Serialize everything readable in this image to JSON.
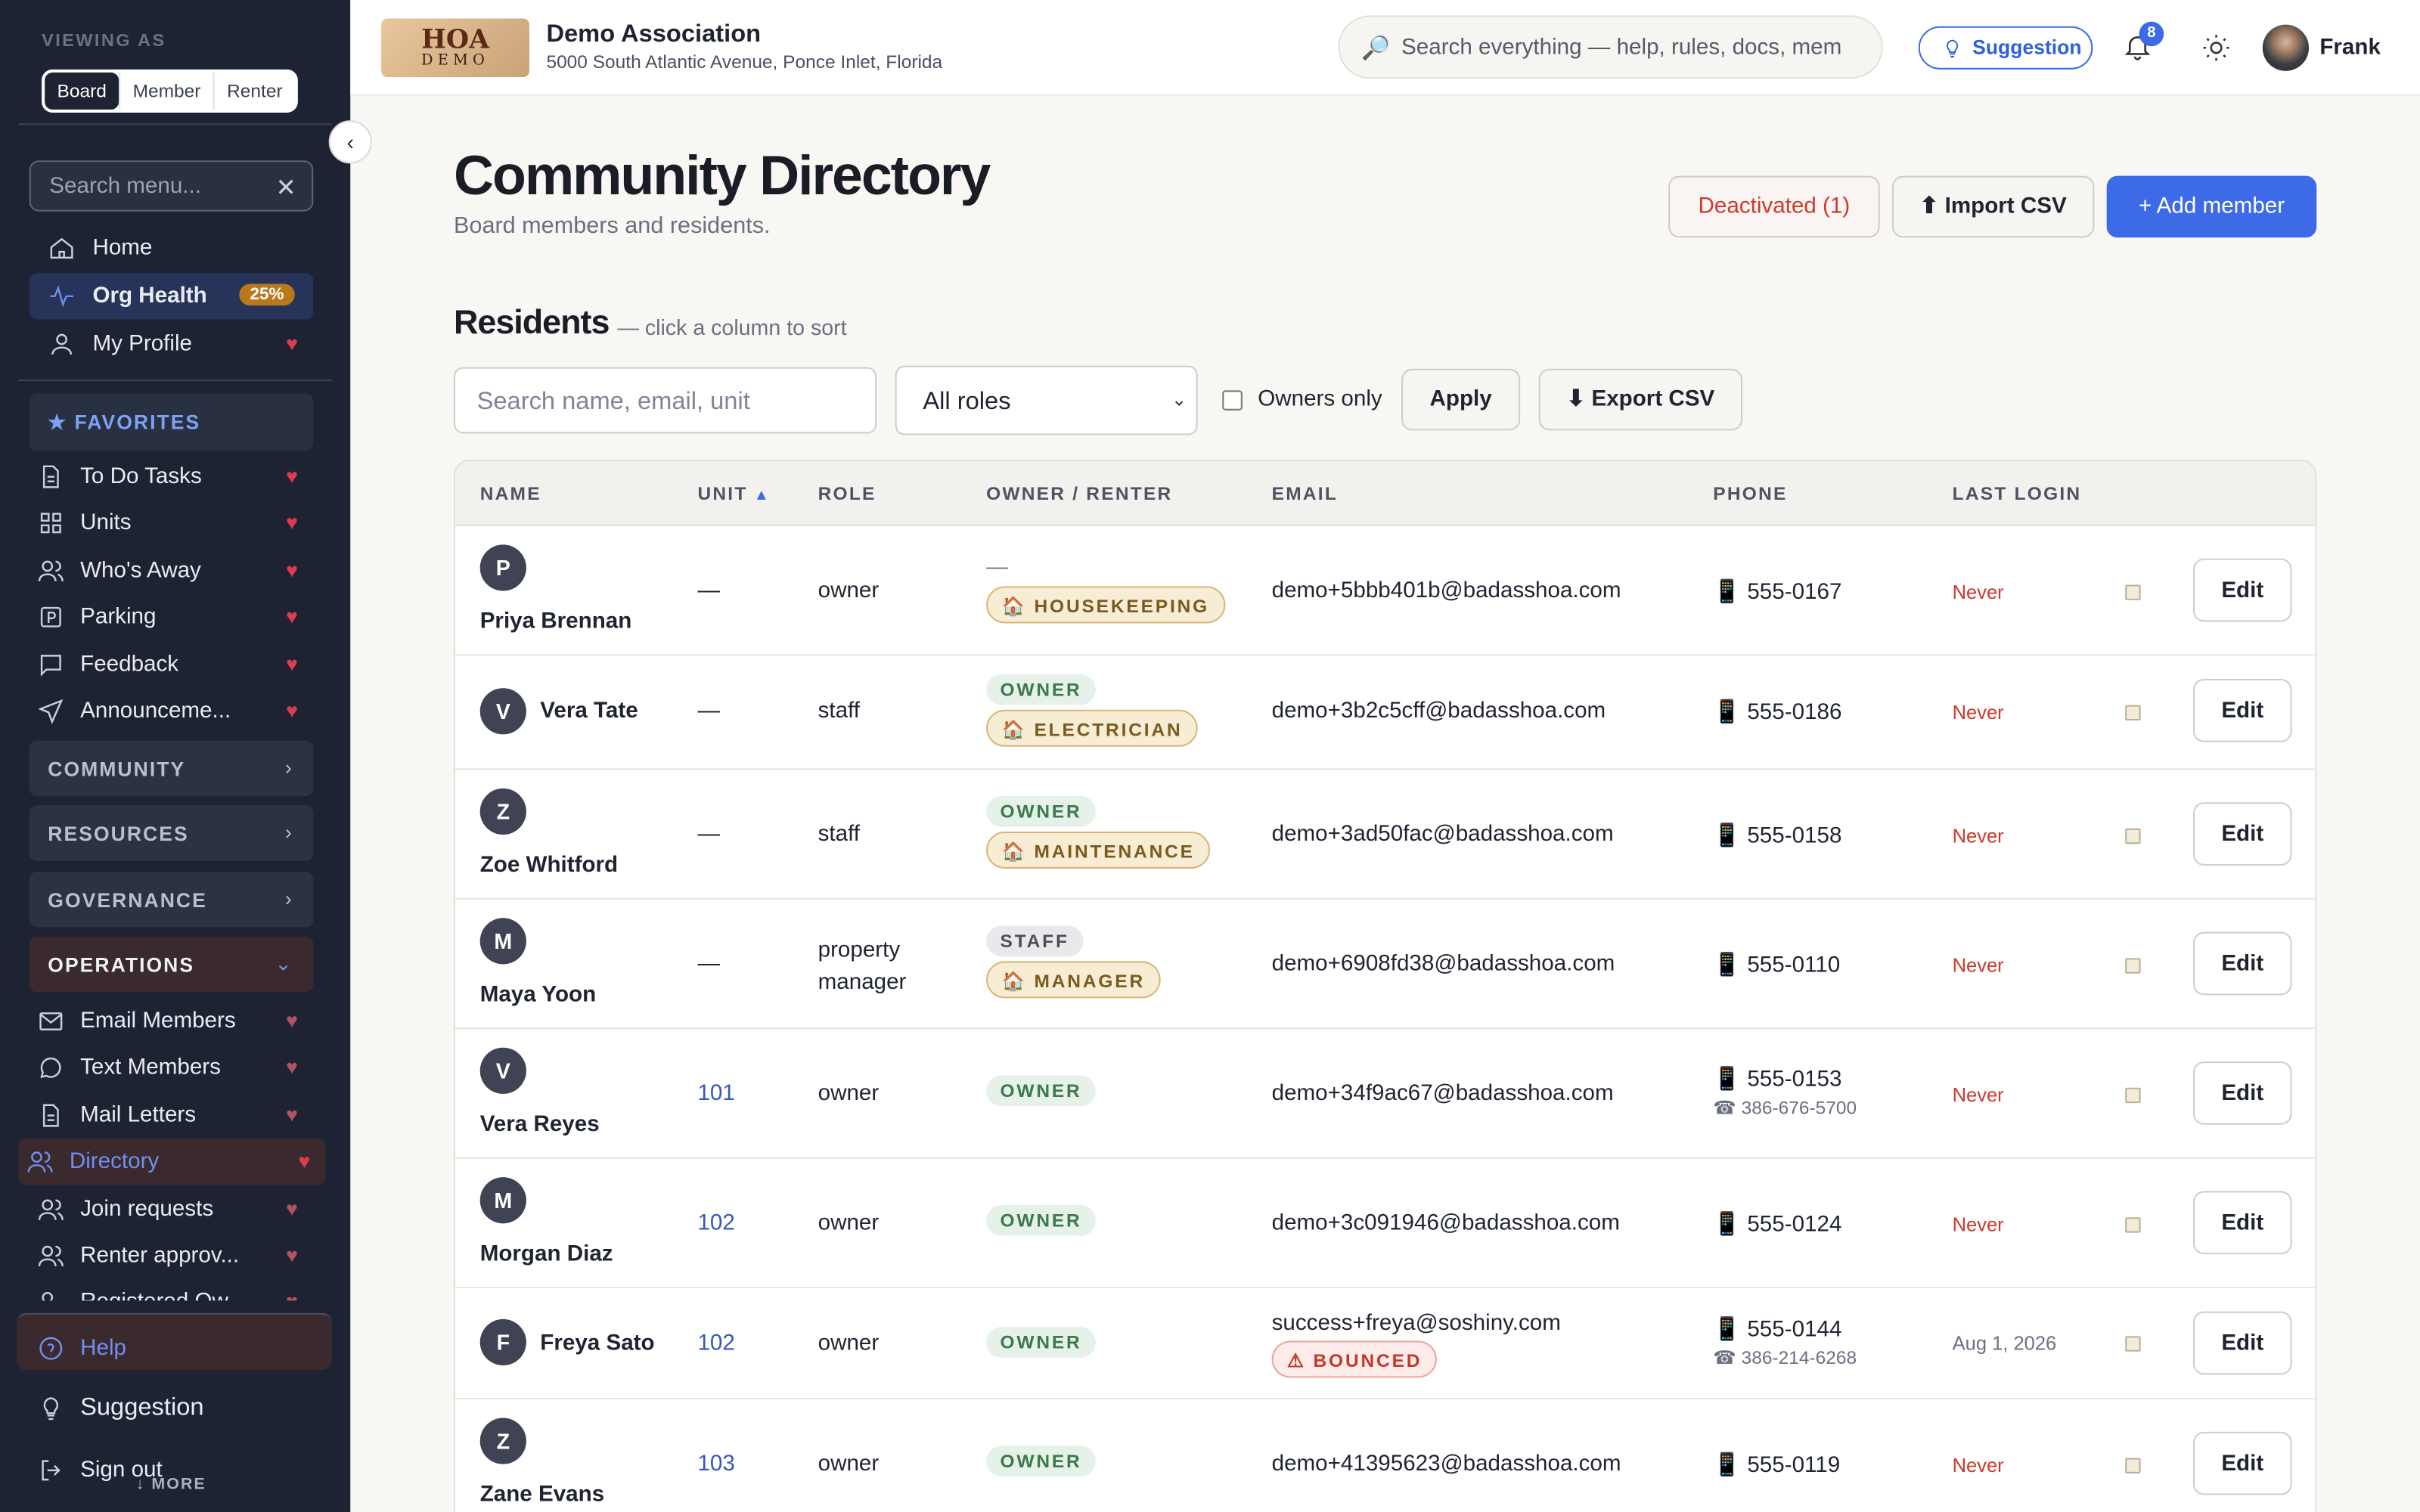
{
  "sidebar": {
    "viewing_as": "VIEWING AS",
    "views": [
      "Board",
      "Member",
      "Renter"
    ],
    "menu_search_placeholder": "Search menu...",
    "home": "Home",
    "org_health": "Org Health",
    "org_health_badge": "25%",
    "my_profile": "My Profile",
    "favorites_header": "★ FAVORITES",
    "favorites": [
      "To Do Tasks",
      "Units",
      "Who's Away",
      "Parking",
      "Feedback",
      "Announceme..."
    ],
    "groups": [
      "COMMUNITY",
      "RESOURCES",
      "GOVERNANCE",
      "OPERATIONS"
    ],
    "operations_items": [
      "Email Members",
      "Text Members",
      "Mail Letters",
      "Directory",
      "Join requests",
      "Renter approv...",
      "Registered Ow..."
    ],
    "help": "Help",
    "suggestion": "Suggestion",
    "sign_out": "Sign out",
    "more": "↓ MORE"
  },
  "topbar": {
    "logo_line1": "HOA",
    "logo_line2": "DEMO",
    "association": "Demo Association",
    "address": "5000 South Atlantic Avenue, Ponce Inlet, Florida",
    "search_placeholder": "Search everything — help, rules, docs, mem",
    "suggestion": "Suggestion",
    "notifications": "8",
    "user": "Frank"
  },
  "page": {
    "title": "Community Directory",
    "subtitle": "Board members and residents.",
    "deactivated": "Deactivated (1)",
    "import": "⬆ Import CSV",
    "add": "+ Add member",
    "section": "Residents",
    "section_note": "— click a column to sort",
    "filter_placeholder": "Search name, email, unit",
    "role_select": "All roles",
    "owners_only": "Owners only",
    "apply": "Apply",
    "export": "⬇ Export CSV"
  },
  "table": {
    "headers": [
      "NAME",
      "UNIT",
      "ROLE",
      "OWNER / RENTER",
      "EMAIL",
      "PHONE",
      "LAST LOGIN"
    ],
    "sort_indicator": "▲",
    "edit_label": "Edit",
    "rows": [
      {
        "initial": "P",
        "name": "Priya Brennan",
        "unit": "—",
        "role": "owner",
        "dash": "—",
        "tag1": "",
        "tag2": "🏠 HOUSEKEEPING",
        "email": "demo+5bbb401b@badasshoa.com",
        "phone": "📱  555-0167",
        "phone2": "",
        "login": "Never"
      },
      {
        "initial": "V",
        "name": "Vera Tate",
        "unit": "—",
        "role": "staff",
        "dash": "",
        "tag1": "OWNER",
        "tag2": "🏠 ELECTRICIAN",
        "email": "demo+3b2c5cff@badasshoa.com",
        "phone": "📱  555-0186",
        "phone2": "",
        "login": "Never"
      },
      {
        "initial": "Z",
        "name": "Zoe Whitford",
        "unit": "—",
        "role": "staff",
        "dash": "",
        "tag1": "OWNER",
        "tag2": "🏠 MAINTENANCE",
        "email": "demo+3ad50fac@badasshoa.com",
        "phone": "📱  555-0158",
        "phone2": "",
        "login": "Never"
      },
      {
        "initial": "M",
        "name": "Maya Yoon",
        "unit": "—",
        "role": "property manager",
        "dash": "",
        "tag1": "STAFF",
        "tag2": "🏠 MANAGER",
        "email": "demo+6908fd38@badasshoa.com",
        "phone": "📱  555-0110",
        "phone2": "",
        "login": "Never"
      },
      {
        "initial": "V",
        "name": "Vera Reyes",
        "unit": "101",
        "role": "owner",
        "dash": "",
        "tag1": "OWNER",
        "tag2": "",
        "email": "demo+34f9ac67@badasshoa.com",
        "phone": "📱  555-0153",
        "phone2": "☎ 386-676-5700",
        "login": "Never"
      },
      {
        "initial": "M",
        "name": "Morgan Diaz",
        "unit": "102",
        "role": "owner",
        "dash": "",
        "tag1": "OWNER",
        "tag2": "",
        "email": "demo+3c091946@badasshoa.com",
        "phone": "📱  555-0124",
        "phone2": "",
        "login": "Never"
      },
      {
        "initial": "F",
        "name": "Freya Sato",
        "unit": "102",
        "role": "owner",
        "dash": "",
        "tag1": "OWNER",
        "tag2": "",
        "email": "success+freya@soshiny.com",
        "bounced": "⚠ BOUNCED",
        "phone": "📱  555-0144",
        "phone2": "☎ 386-214-6268",
        "login": "Aug 1, 2026"
      },
      {
        "initial": "Z",
        "name": "Zane Evans",
        "unit": "103",
        "role": "owner",
        "dash": "",
        "tag1": "OWNER",
        "tag2": "",
        "email": "demo+41395623@badasshoa.com",
        "phone": "📱  555-0119",
        "phone2": "",
        "login": "Never"
      }
    ]
  },
  "colors": {
    "accent": "#3d6be8",
    "sidebar": "#1d2332",
    "danger": "#cc3a2e",
    "owner_tag": "#3b7a4a"
  }
}
